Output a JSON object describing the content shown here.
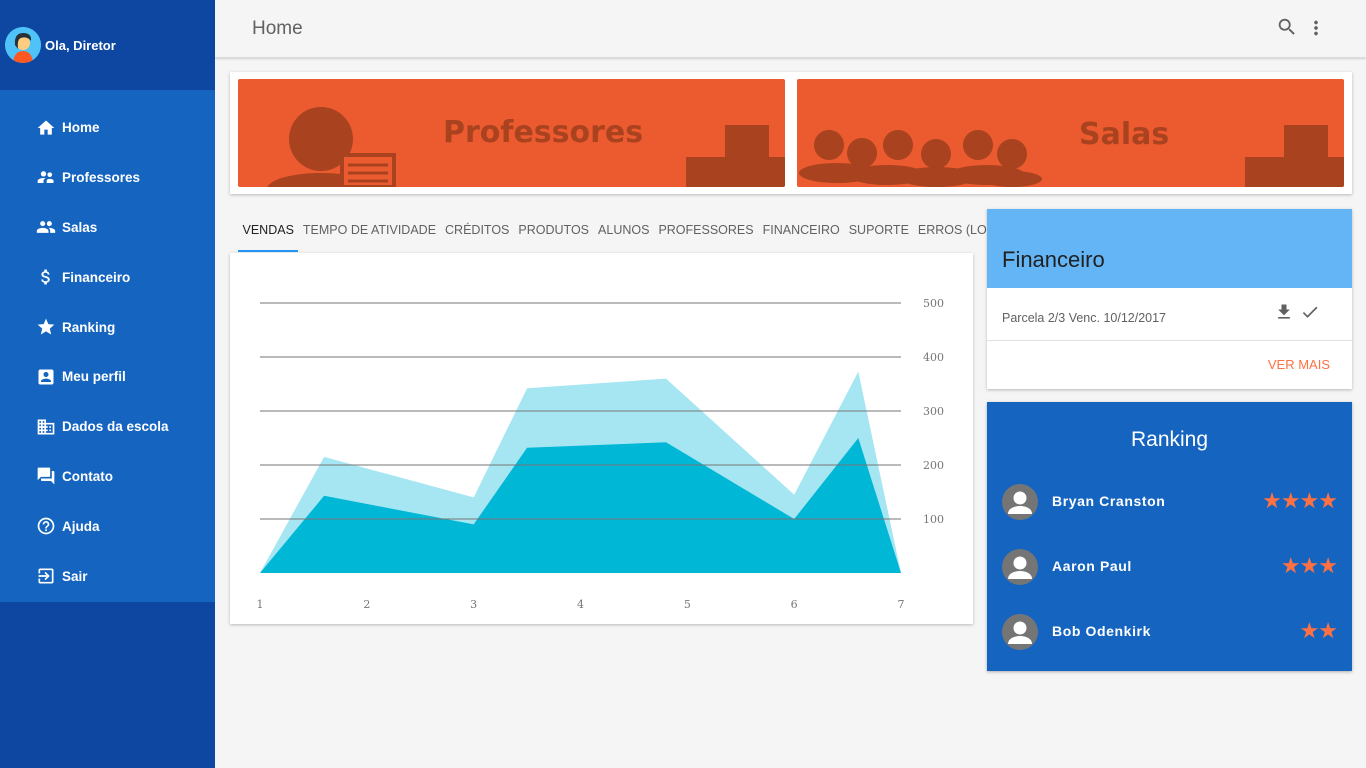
{
  "sidebar": {
    "greeting": "Ola, Diretor",
    "items": [
      {
        "label": "Home",
        "icon": "home-icon"
      },
      {
        "label": "Professores",
        "icon": "supervisor-account-icon"
      },
      {
        "label": "Salas",
        "icon": "group-icon"
      },
      {
        "label": "Financeiro",
        "icon": "dollar-icon"
      },
      {
        "label": "Ranking",
        "icon": "star-icon"
      },
      {
        "label": "Meu perfil",
        "icon": "account-box-icon"
      },
      {
        "label": "Dados da escola",
        "icon": "business-icon"
      },
      {
        "label": "Contato",
        "icon": "forum-icon"
      },
      {
        "label": "Ajuda",
        "icon": "help-icon"
      },
      {
        "label": "Sair",
        "icon": "exit-icon"
      }
    ]
  },
  "header": {
    "title": "Home"
  },
  "banners": {
    "professores": "Professores",
    "salas": "Salas"
  },
  "tabs": [
    "VENDAS",
    "TEMPO DE ATIVIDADE",
    "CRÉDITOS",
    "PRODUTOS",
    "ALUNOS",
    "PROFESSORES",
    "FINANCEIRO",
    "SUPORTE",
    "ERROS (LOGS)"
  ],
  "chart_data": {
    "type": "area",
    "x": [
      1,
      1.6,
      3,
      3.5,
      4.8,
      6,
      6.6,
      7
    ],
    "xticks": [
      "1",
      "2",
      "3",
      "4",
      "5",
      "6",
      "7"
    ],
    "yticks": [
      "100",
      "200",
      "300",
      "400",
      "500"
    ],
    "ylim": [
      0,
      500
    ],
    "series": [
      {
        "values": [
          0,
          215,
          140,
          342,
          360,
          145,
          373,
          0
        ],
        "color": "#a6e6f2"
      },
      {
        "values": [
          0,
          143,
          90,
          232,
          242,
          100,
          250,
          0
        ],
        "color": "#00b7d6"
      }
    ],
    "grid": true
  },
  "financeiro": {
    "title": "Financeiro",
    "row": "Parcela 2/3 Venc. 10/12/2017",
    "more": "VER MAIS"
  },
  "ranking": {
    "title": "Ranking",
    "items": [
      {
        "name": "Bryan Cranston",
        "stars": "★★★★"
      },
      {
        "name": "Aaron Paul",
        "stars": "★★★"
      },
      {
        "name": "Bob Odenkirk",
        "stars": "★★"
      }
    ]
  },
  "colors": {
    "sidebar": "#1565c0",
    "sidebar_dark": "#0d47a1",
    "banner": "#ec5a2f",
    "accent": "#ff7043",
    "fin_header": "#64b5f6"
  }
}
